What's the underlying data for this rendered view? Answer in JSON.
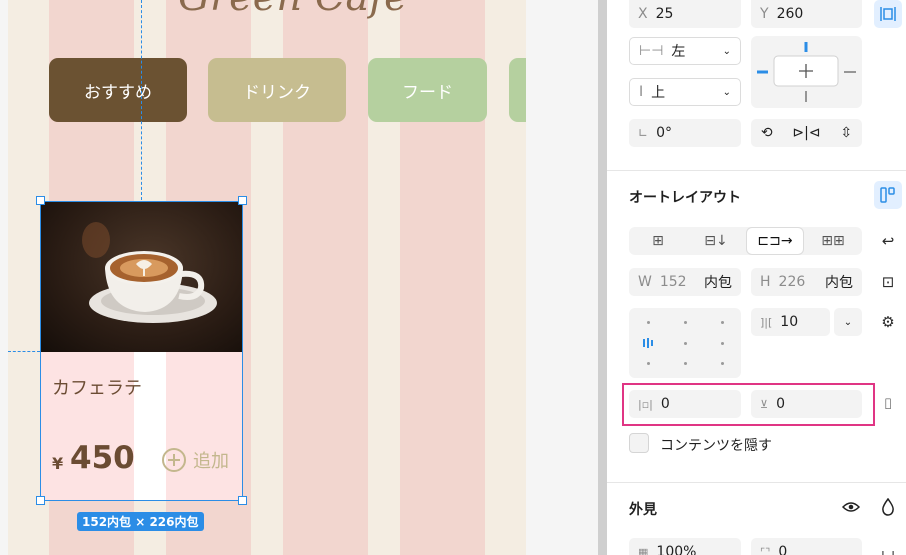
{
  "canvas": {
    "brand_partial": "Green Cafe",
    "categories": [
      "おすすめ",
      "ドリンク",
      "フード",
      ""
    ],
    "card": {
      "name": "カフェラテ",
      "currency": "¥",
      "price": "450",
      "add_label": "追加"
    },
    "size_badge": "152内包 × 226内包"
  },
  "panel": {
    "position": {
      "x_label": "X",
      "x_value": "25",
      "y_label": "Y",
      "y_value": "260"
    },
    "align_h": "左",
    "align_v": "上",
    "rotation": "0°",
    "auto_layout": {
      "title": "オートレイアウト",
      "width_label": "W",
      "width_value": "152",
      "width_mode": "内包",
      "height_label": "H",
      "height_value": "226",
      "height_mode": "内包",
      "gap": "10",
      "padding_h": "0",
      "padding_v": "0",
      "clip_content_label": "コンテンツを隠す",
      "clip_content_checked": false
    },
    "appearance": {
      "title": "外見",
      "opacity": "100%",
      "radius": "0"
    }
  },
  "colors": {
    "selection": "#2b8de6",
    "highlight": "#e03584",
    "primary_category": "#6b5232"
  }
}
